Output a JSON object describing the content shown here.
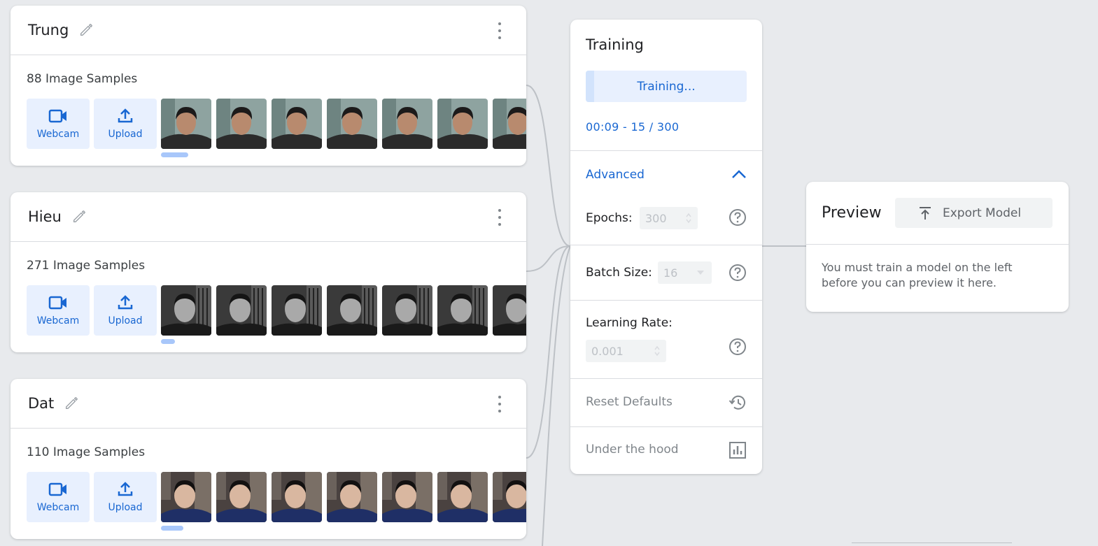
{
  "classes": [
    {
      "name": "Trung",
      "sample_count": "88 Image Samples",
      "webcam_label": "Webcam",
      "upload_label": "Upload",
      "thumbnail_count": 7
    },
    {
      "name": "Hieu",
      "sample_count": "271 Image Samples",
      "webcam_label": "Webcam",
      "upload_label": "Upload",
      "thumbnail_count": 7
    },
    {
      "name": "Dat",
      "sample_count": "110 Image Samples",
      "webcam_label": "Webcam",
      "upload_label": "Upload",
      "thumbnail_count": 7
    }
  ],
  "training": {
    "title": "Training",
    "button_label": "Training...",
    "progress_fraction": 0.05,
    "status": "00:09 - 15 / 300",
    "advanced_label": "Advanced",
    "advanced_expanded": true,
    "epochs_label": "Epochs:",
    "epochs_value": "300",
    "batch_size_label": "Batch Size:",
    "batch_size_value": "16",
    "learning_rate_label": "Learning Rate:",
    "learning_rate_value": "0.001",
    "reset_defaults_label": "Reset Defaults",
    "under_the_hood_label": "Under the hood"
  },
  "preview": {
    "title": "Preview",
    "export_label": "Export Model",
    "message": "You must train a model on the left before you can preview it here."
  },
  "colors": {
    "accent": "#1967d2",
    "accent_light": "#e8f0fe",
    "background": "#e8eaed",
    "muted_text": "#80868b"
  },
  "icons": [
    "pencil-icon",
    "more-vert-icon",
    "videocam-icon",
    "upload-icon",
    "chevron-up-icon",
    "help-icon",
    "history-icon",
    "bar-chart-icon",
    "export-icon"
  ]
}
